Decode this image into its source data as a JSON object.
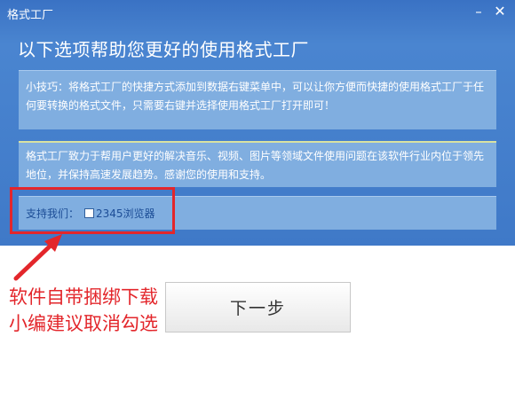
{
  "window": {
    "title": "格式工厂",
    "minimize_symbol": "–",
    "close_symbol": "✕"
  },
  "heading": "以下选项帮助您更好的使用格式工厂",
  "tip": {
    "text": "小技巧：将格式工厂的快捷方式添加到数据右键菜单中，可以让你方便而快捷的使用格式工厂于任何要转换的格式文件，只需要右键并选择使用格式工厂打开即可！"
  },
  "about": {
    "text": "格式工厂致力于帮用户更好的解决音乐、视频、图片等领域文件使用问题在该软件行业内位于领先地位，并保持高速发展趋势。感谢您的使用和支持。"
  },
  "support": {
    "label": "支持我们：",
    "checkbox_label": "2345浏览器",
    "checked": false
  },
  "annotation": {
    "line1": "软件自带捆绑下载",
    "line2": "小编建议取消勾选"
  },
  "buttons": {
    "next_label": "下一步"
  },
  "colors": {
    "header_bg": "#3f78c8",
    "panel_bg": "#80aee0",
    "annotation": "#e3262b"
  },
  "icons": {
    "minimize": "minimize-icon",
    "close": "close-icon",
    "arrow": "annotation-arrow"
  }
}
